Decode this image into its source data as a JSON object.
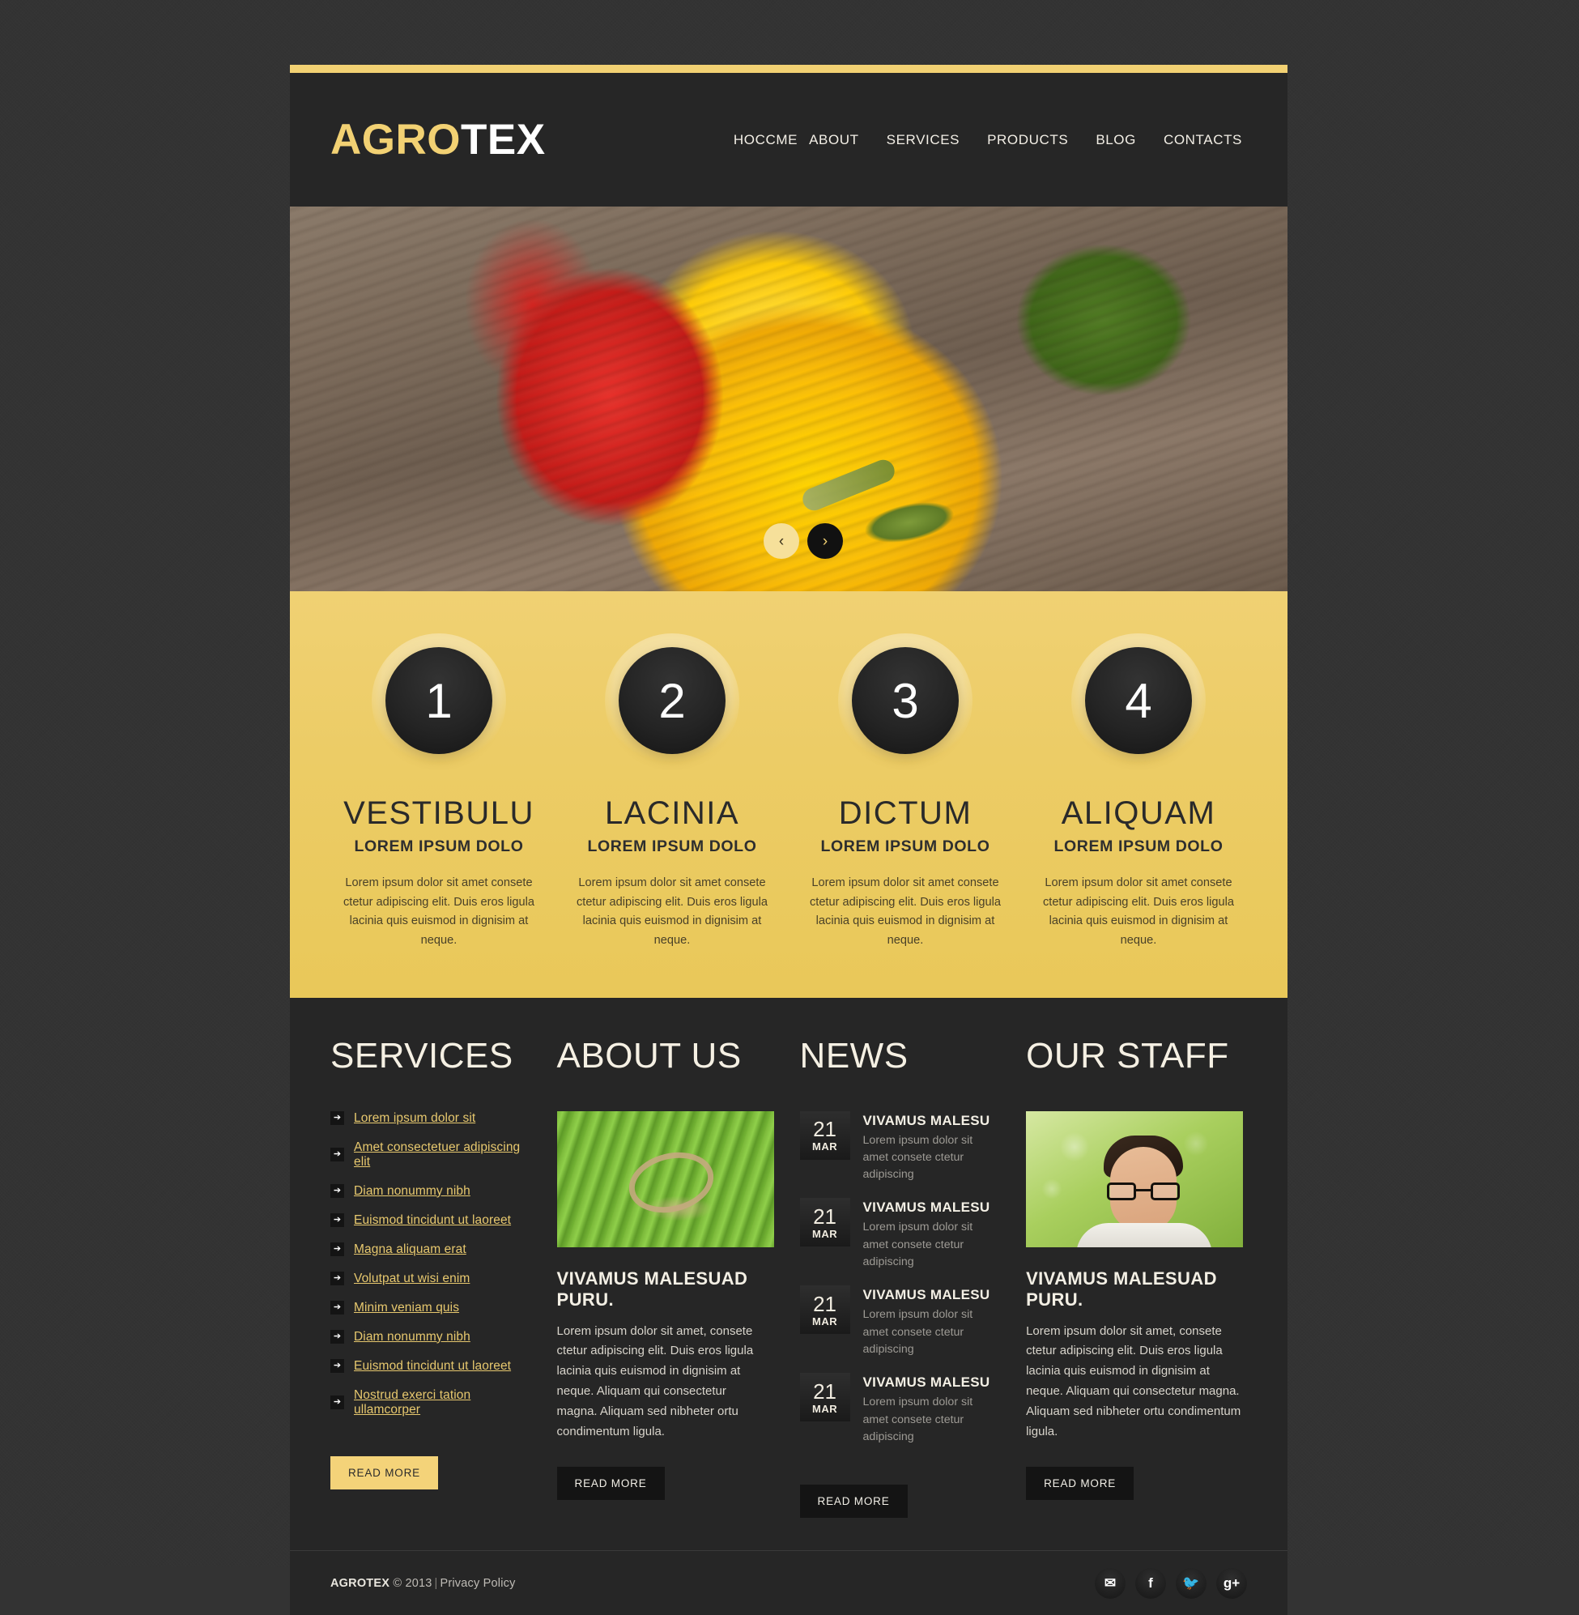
{
  "site": {
    "logo_yellow": "AGRO",
    "logo_white": "TEX",
    "accent": "#f2d173",
    "dark": "#262626"
  },
  "nav": {
    "items": [
      {
        "label": "HOCCME"
      },
      {
        "label": "ABOUT"
      },
      {
        "label": "SERVICES"
      },
      {
        "label": "PRODUCTS"
      },
      {
        "label": "BLOG"
      },
      {
        "label": "CONTACTS"
      }
    ]
  },
  "hero": {
    "prev_icon": "chevron-left",
    "prev_glyph": "‹",
    "next_icon": "chevron-right",
    "next_glyph": "›"
  },
  "features": [
    {
      "number": "1",
      "title": "VESTIBULU",
      "subtitle": "LOREM IPSUM DOLO",
      "text": "Lorem ipsum dolor sit amet consete ctetur adipiscing elit. Duis eros ligula lacinia quis euismod in dignisim at neque."
    },
    {
      "number": "2",
      "title": "LACINIA",
      "subtitle": "LOREM IPSUM DOLO",
      "text": "Lorem ipsum dolor sit amet consete ctetur adipiscing elit. Duis eros ligula lacinia quis euismod in dignisim at neque."
    },
    {
      "number": "3",
      "title": "DICTUM",
      "subtitle": "LOREM IPSUM DOLO",
      "text": "Lorem ipsum dolor sit amet consete ctetur adipiscing elit. Duis eros ligula lacinia quis euismod in dignisim at neque."
    },
    {
      "number": "4",
      "title": "ALIQUAM",
      "subtitle": "LOREM IPSUM DOLO",
      "text": "Lorem ipsum dolor sit amet consete ctetur adipiscing elit. Duis eros ligula lacinia quis euismod in dignisim at neque."
    }
  ],
  "services": {
    "heading": "SERVICES",
    "marker_glyph": "➔",
    "links": [
      "Lorem ipsum dolor sit",
      "Amet consectetuer adipiscing elit",
      "Diam nonummy nibh",
      "Euismod tincidunt ut laoreet",
      "Magna aliquam erat",
      "Volutpat ut wisi enim",
      "Minim veniam quis",
      "Diam nonummy nibh",
      "Euismod tincidunt ut laoreet",
      "Nostrud exerci tation ullamcorper"
    ],
    "read_more": "READ MORE"
  },
  "about": {
    "heading": "ABOUT US",
    "title": "VIVAMUS MALESUAD PURU.",
    "text": "Lorem ipsum dolor sit amet, consete ctetur adipiscing elit. Duis eros ligula lacinia quis euismod in dignisim at neque. Aliquam qui consectetur magna. Aliquam sed nibheter ortu condimentum ligula.",
    "read_more": "READ MORE"
  },
  "news": {
    "heading": "NEWS",
    "items": [
      {
        "day": "21",
        "month": "MAR",
        "title": "VIVAMUS MALESU",
        "text": "Lorem ipsum dolor sit amet consete ctetur adipiscing"
      },
      {
        "day": "21",
        "month": "MAR",
        "title": "VIVAMUS MALESU",
        "text": "Lorem ipsum dolor sit amet consete ctetur adipiscing"
      },
      {
        "day": "21",
        "month": "MAR",
        "title": "VIVAMUS MALESU",
        "text": "Lorem ipsum dolor sit amet consete ctetur adipiscing"
      },
      {
        "day": "21",
        "month": "MAR",
        "title": "VIVAMUS MALESU",
        "text": "Lorem ipsum dolor sit amet consete ctetur adipiscing"
      }
    ],
    "read_more": "READ MORE"
  },
  "staff": {
    "heading": "OUR STAFF",
    "title": "VIVAMUS MALESUAD PURU.",
    "text": "Lorem ipsum dolor sit amet, consete ctetur adipiscing elit. Duis eros ligula lacinia quis euismod in dignisim at neque. Aliquam qui consectetur magna. Aliquam sed nibheter ortu condimentum ligula.",
    "read_more": "READ MORE"
  },
  "footer": {
    "brand": "AGROTEX",
    "copyright": "© 2013",
    "separator": "|",
    "privacy": "Privacy Policy",
    "socials": [
      {
        "name": "email-icon",
        "glyph": "✉"
      },
      {
        "name": "facebook-icon",
        "glyph": "f"
      },
      {
        "name": "twitter-icon",
        "glyph": "🐦"
      },
      {
        "name": "googleplus-icon",
        "glyph": "g+"
      }
    ]
  }
}
